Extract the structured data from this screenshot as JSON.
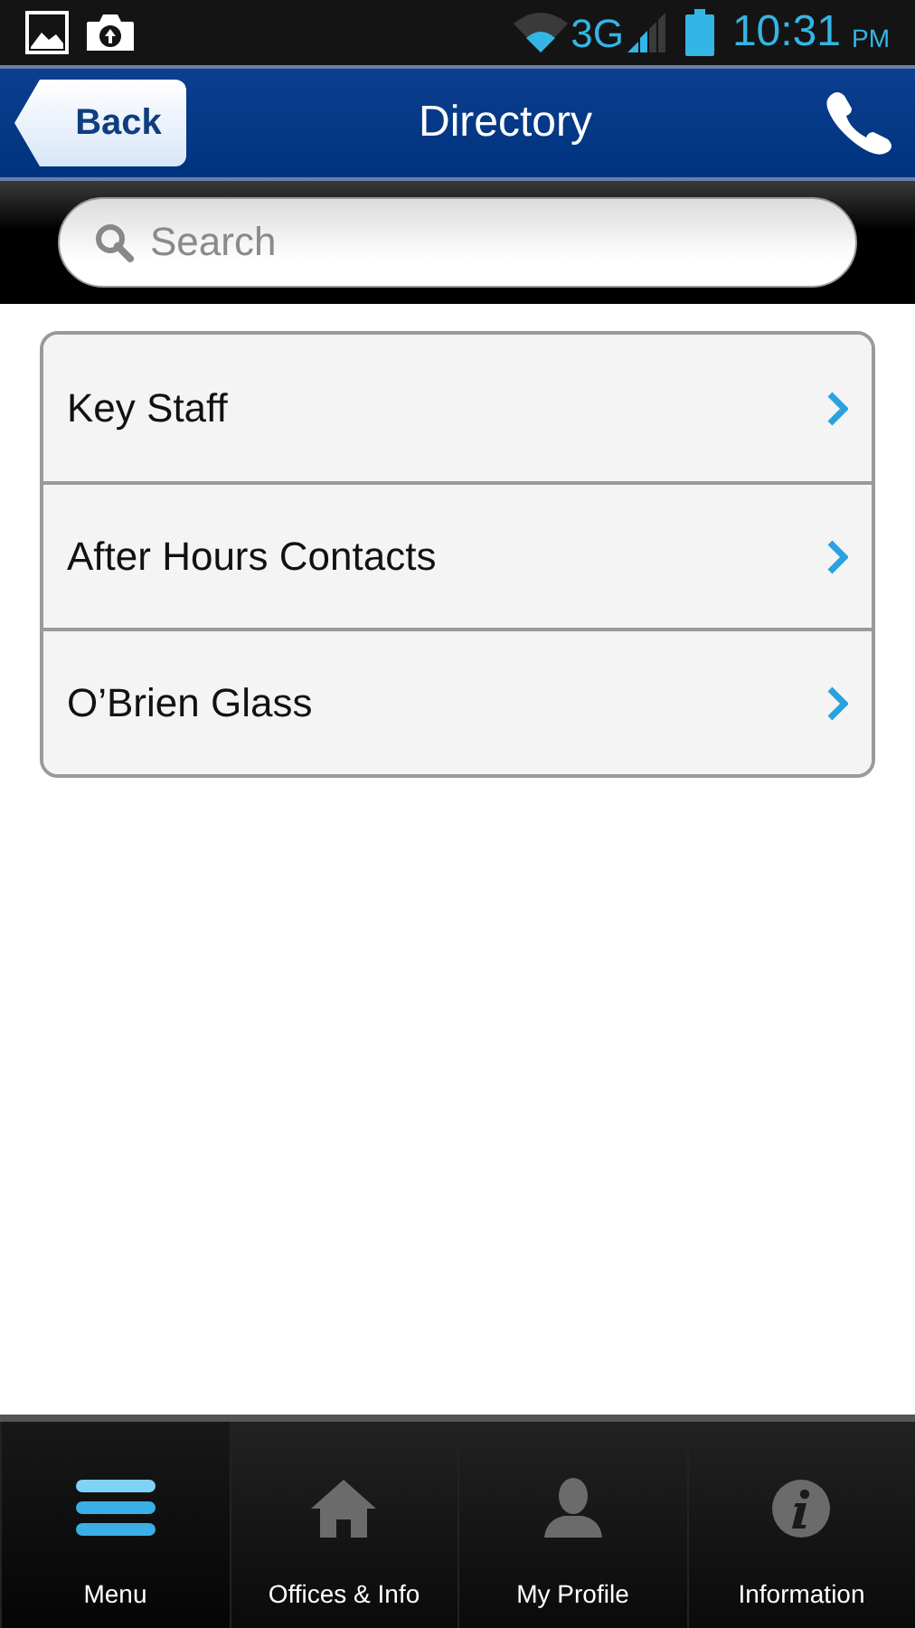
{
  "status_bar": {
    "network": "3G",
    "time": "10:31",
    "meridiem": "PM"
  },
  "header": {
    "back": "Back",
    "title": "Directory"
  },
  "search": {
    "placeholder": "Search"
  },
  "items": [
    {
      "label": "Key Staff"
    },
    {
      "label": "After Hours Contacts"
    },
    {
      "label": "O’Brien Glass"
    }
  ],
  "tabs": [
    {
      "kind": "menu",
      "label": "Menu",
      "selected": true
    },
    {
      "kind": "home",
      "label": "Offices & Info",
      "selected": false
    },
    {
      "kind": "profile",
      "label": "My Profile",
      "selected": false
    },
    {
      "kind": "info",
      "label": "Information",
      "selected": false
    }
  ]
}
